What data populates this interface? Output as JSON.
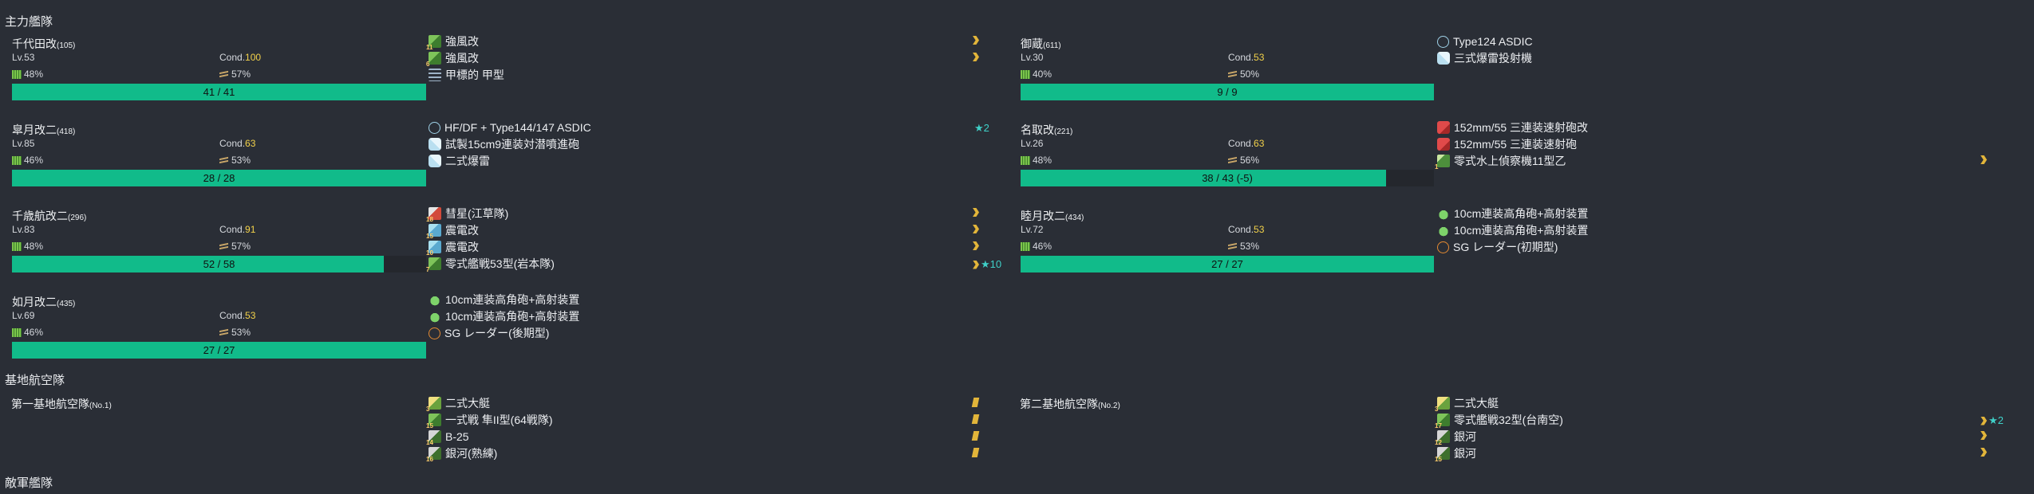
{
  "sections": {
    "main_fleet": "主力艦隊",
    "base_air": "基地航空隊",
    "enemy_fleet": "敵軍艦隊"
  },
  "ships": [
    {
      "name": "千代田改",
      "id": "(105)",
      "lv": "Lv.53",
      "cond_label": "Cond.",
      "cond": "100",
      "fuel": "48%",
      "ammo": "57%",
      "hp": "41 / 41",
      "hp_ratio": 1.0,
      "equips": [
        {
          "icon": "fighter-icon",
          "count": "11",
          "name": "強風改",
          "prof": "chevron"
        },
        {
          "icon": "fighter-icon",
          "count": "6",
          "name": "強風改",
          "prof": "chevron"
        },
        {
          "icon": "armor-icon",
          "count": "",
          "name": "甲標的 甲型",
          "prof": ""
        }
      ]
    },
    {
      "name": "御蔵",
      "id": "(611)",
      "lv": "Lv.30",
      "cond_label": "Cond.",
      "cond": "53",
      "fuel": "40%",
      "ammo": "50%",
      "hp": "9 / 9",
      "hp_ratio": 1.0,
      "equips": [
        {
          "icon": "sonar-icon",
          "count": "",
          "name": "Type124 ASDIC",
          "prof": ""
        },
        {
          "icon": "depth-charge-icon",
          "count": "",
          "name": "三式爆雷投射機",
          "prof": ""
        }
      ]
    },
    {
      "name": "皐月改二",
      "id": "(418)",
      "lv": "Lv.85",
      "cond_label": "Cond.",
      "cond": "63",
      "fuel": "46%",
      "ammo": "53%",
      "hp": "28 / 28",
      "hp_ratio": 1.0,
      "equips": [
        {
          "icon": "sonar-icon",
          "count": "",
          "name": "HF/DF + Type144/147 ASDIC",
          "prof": "",
          "star": "★2"
        },
        {
          "icon": "depth-charge-icon",
          "count": "",
          "name": "試製15cm9連装対潜噴進砲",
          "prof": ""
        },
        {
          "icon": "depth-charge-icon",
          "count": "",
          "name": "二式爆雷",
          "prof": ""
        }
      ]
    },
    {
      "name": "名取改",
      "id": "(221)",
      "lv": "Lv.26",
      "cond_label": "Cond.",
      "cond": "63",
      "fuel": "48%",
      "ammo": "56%",
      "hp": "38 / 43 (-5)",
      "hp_ratio": 0.884,
      "equips": [
        {
          "icon": "red-gun-icon",
          "count": "",
          "name": "152mm/55 三連装速射砲改",
          "prof": ""
        },
        {
          "icon": "red-gun-icon",
          "count": "",
          "name": "152mm/55 三連装速射砲",
          "prof": ""
        },
        {
          "icon": "seaplane-icon",
          "count": "1",
          "name": "零式水上偵察機11型乙",
          "prof": "chevron"
        }
      ]
    },
    {
      "name": "千歳航改二",
      "id": "(296)",
      "lv": "Lv.83",
      "cond_label": "Cond.",
      "cond": "91",
      "fuel": "48%",
      "ammo": "57%",
      "hp": "52 / 58",
      "hp_ratio": 0.897,
      "equips": [
        {
          "icon": "bomber-icon",
          "count": "18",
          "name": "彗星(江草隊)",
          "prof": "chevron"
        },
        {
          "icon": "torpedo-bomber-icon",
          "count": "15",
          "name": "震電改",
          "prof": "chevron"
        },
        {
          "icon": "torpedo-bomber-icon",
          "count": "10",
          "name": "震電改",
          "prof": "chevron"
        },
        {
          "icon": "fighter-icon",
          "count": "7",
          "name": "零式艦戦53型(岩本隊)",
          "prof": "chevron",
          "star": "★10"
        }
      ]
    },
    {
      "name": "睦月改二",
      "id": "(434)",
      "lv": "Lv.72",
      "cond_label": "Cond.",
      "cond": "53",
      "fuel": "46%",
      "ammo": "53%",
      "hp": "27 / 27",
      "hp_ratio": 1.0,
      "equips": [
        {
          "icon": "green-gun-icon",
          "count": "",
          "name": "10cm連装高角砲+高射装置",
          "prof": ""
        },
        {
          "icon": "green-gun-icon",
          "count": "",
          "name": "10cm連装高角砲+高射装置",
          "prof": ""
        },
        {
          "icon": "radar-icon",
          "count": "",
          "name": "SG レーダー(初期型)",
          "prof": ""
        }
      ]
    },
    {
      "name": "如月改二",
      "id": "(435)",
      "lv": "Lv.69",
      "cond_label": "Cond.",
      "cond": "53",
      "fuel": "46%",
      "ammo": "53%",
      "hp": "27 / 27",
      "hp_ratio": 1.0,
      "equips": [
        {
          "icon": "green-gun-icon",
          "count": "",
          "name": "10cm連装高角砲+高射装置",
          "prof": ""
        },
        {
          "icon": "green-gun-icon",
          "count": "",
          "name": "10cm連装高角砲+高射装置",
          "prof": ""
        },
        {
          "icon": "radar-icon",
          "count": "",
          "name": "SG レーダー(後期型)",
          "prof": ""
        }
      ]
    }
  ],
  "bases": [
    {
      "name": "第一基地航空隊",
      "id": "(No.1)",
      "equips": [
        {
          "icon": "flying-boat-icon",
          "count": "3",
          "name": "二式大艇",
          "prof": "bar"
        },
        {
          "icon": "fighter-icon",
          "count": "15",
          "name": "一式戦 隼II型(64戦隊)",
          "prof": "bar"
        },
        {
          "icon": "land-bomber-icon",
          "count": "14",
          "name": "B-25",
          "prof": "bar"
        },
        {
          "icon": "land-bomber-icon",
          "count": "16",
          "name": "銀河(熟練)",
          "prof": "bar"
        }
      ]
    },
    {
      "name": "第二基地航空隊",
      "id": "(No.2)",
      "equips": [
        {
          "icon": "flying-boat-icon",
          "count": "3",
          "name": "二式大艇",
          "prof": ""
        },
        {
          "icon": "fighter-icon",
          "count": "17",
          "name": "零式艦戦32型(台南空)",
          "prof": "chevron",
          "star": "★2"
        },
        {
          "icon": "land-bomber-icon",
          "count": "12",
          "name": "銀河",
          "prof": "chevron"
        },
        {
          "icon": "land-bomber-icon",
          "count": "15",
          "name": "銀河",
          "prof": "chevron"
        }
      ]
    }
  ]
}
